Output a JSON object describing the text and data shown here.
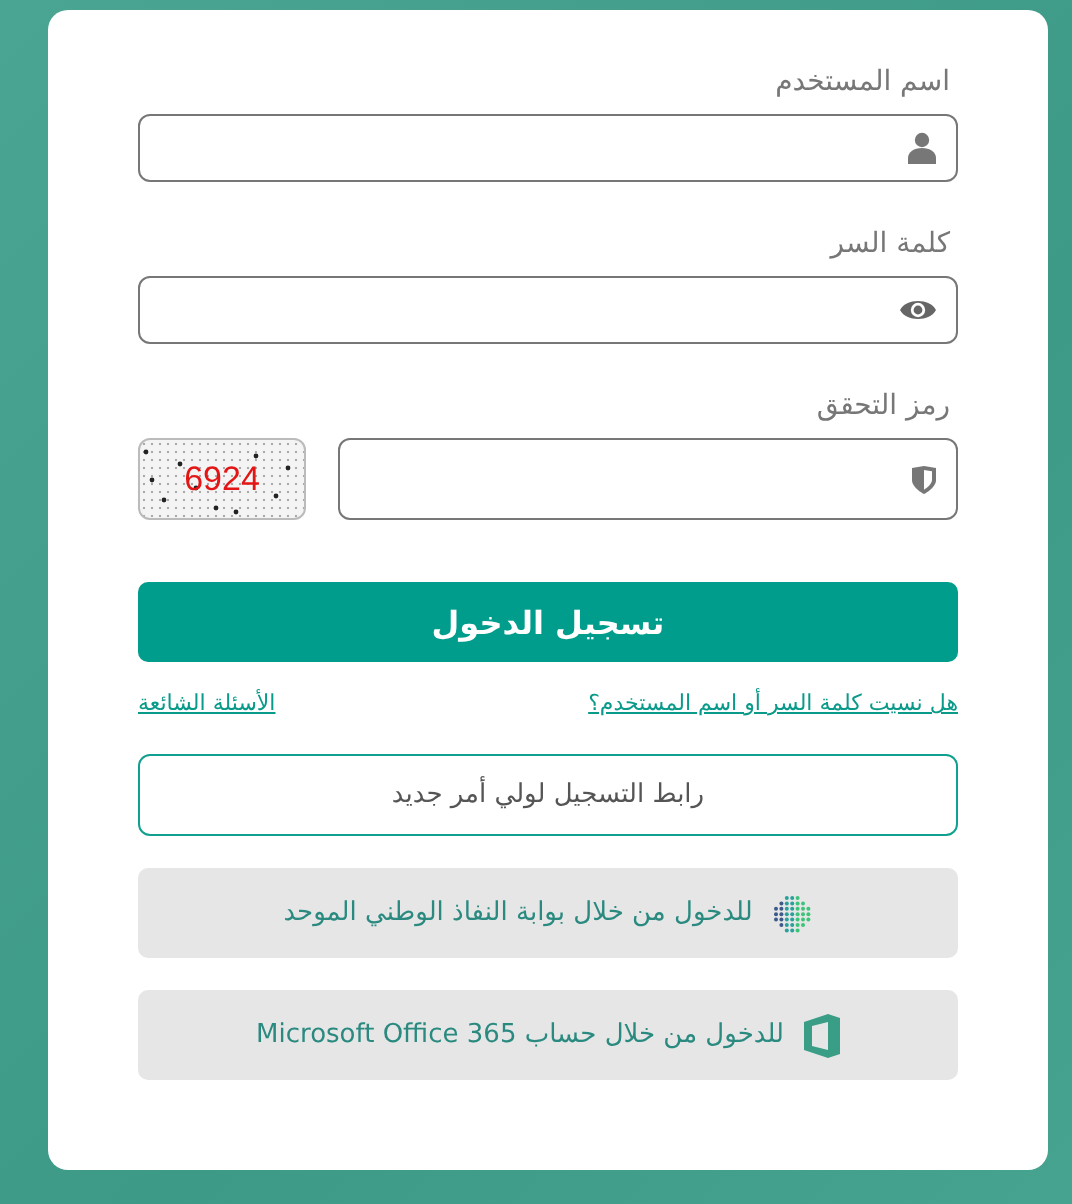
{
  "fields": [
    {
      "label": "اسم المستخدم",
      "kind": "user"
    },
    {
      "label": "كلمة السر",
      "kind": "password"
    }
  ],
  "captcha": {
    "label": "رمز التحقق",
    "code": "6924"
  },
  "login_button": "تسجيل الدخول",
  "links": [
    {
      "text": "هل نسيت كلمة السر أو اسم المستخدم؟"
    },
    {
      "text": "الأسئلة الشائعة"
    }
  ],
  "register_button": "رابط التسجيل لولي أمر جديد",
  "sso_buttons": [
    {
      "kind": "nafath",
      "text": "للدخول من خلال بوابة النفاذ الوطني الموحد"
    },
    {
      "kind": "office",
      "text": "للدخول من خلال حساب Microsoft Office 365"
    }
  ]
}
